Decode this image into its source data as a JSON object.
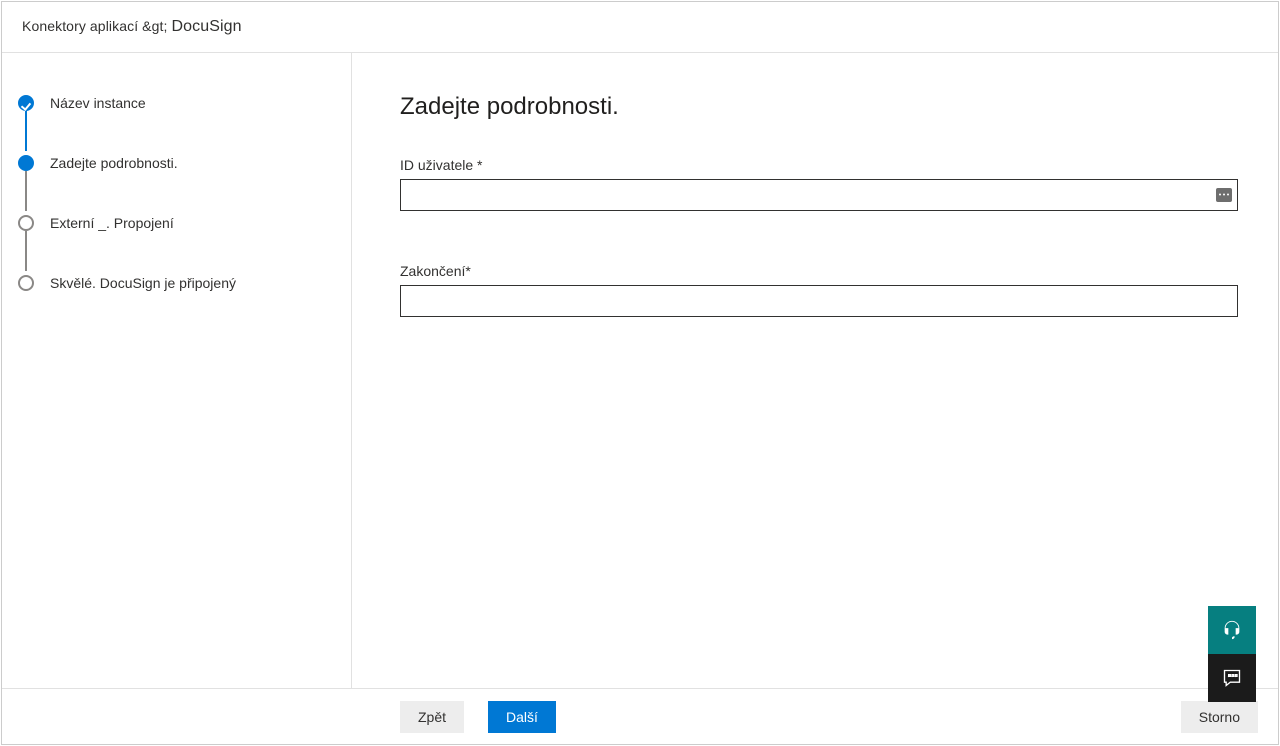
{
  "breadcrumb": {
    "prefix": "Konektory aplikací &gt;",
    "connector": "DocuSign"
  },
  "steps": [
    {
      "label": "Název instance",
      "state": "completed"
    },
    {
      "label": "Zadejte podrobnosti.",
      "state": "current"
    },
    {
      "label": "Externí _. Propojení",
      "state": "future"
    },
    {
      "label": "Skvělé. DocuSign je připojený",
      "state": "future"
    }
  ],
  "main": {
    "title": "Zadejte podrobnosti.",
    "fields": {
      "user_id": {
        "label": "ID uživatele *",
        "value": ""
      },
      "termination": {
        "label": "Zakončení*",
        "value": ""
      }
    }
  },
  "footer": {
    "back": "Zpět",
    "next": "Další",
    "cancel": "Storno"
  },
  "float": {
    "support_icon": "headset-icon",
    "feedback_icon": "speech-bubble-icon"
  }
}
